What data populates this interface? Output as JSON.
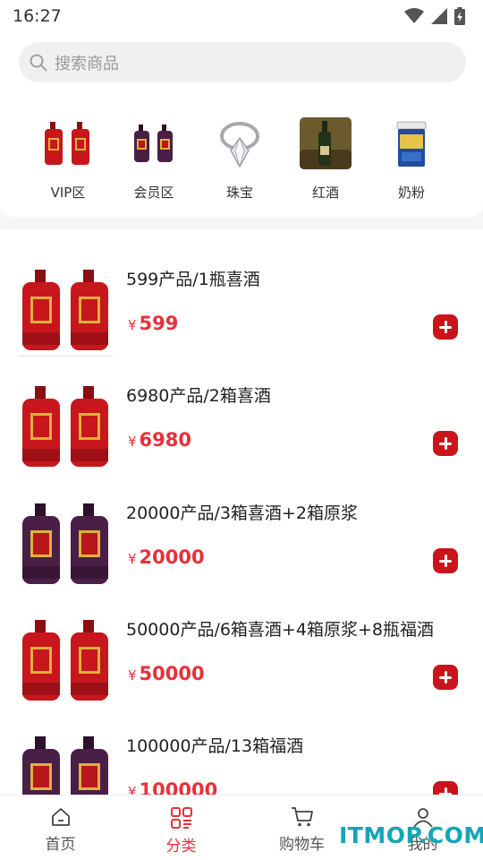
{
  "status_bar": {
    "time": "16:27"
  },
  "search": {
    "placeholder": "搜索商品"
  },
  "categories": [
    {
      "label": "VIP区",
      "icon": "red-liquor-bottles"
    },
    {
      "label": "会员区",
      "icon": "purple-liquor-bottles"
    },
    {
      "label": "珠宝",
      "icon": "diamond-ring"
    },
    {
      "label": "红酒",
      "icon": "red-wine-bottle"
    },
    {
      "label": "奶粉",
      "icon": "milk-powder-can"
    }
  ],
  "products": [
    {
      "title": "599产品/1瓶喜酒",
      "currency": "¥",
      "price": "599",
      "bottle_color": "red"
    },
    {
      "title": "6980产品/2箱喜酒",
      "currency": "¥",
      "price": "6980",
      "bottle_color": "red"
    },
    {
      "title": "20000产品/3箱喜酒+2箱原浆",
      "currency": "¥",
      "price": "20000",
      "bottle_color": "purple"
    },
    {
      "title": "50000产品/6箱喜酒+4箱原浆+8瓶福酒",
      "currency": "¥",
      "price": "50000",
      "bottle_color": "red"
    },
    {
      "title": "100000产品/13箱福酒",
      "currency": "¥",
      "price": "100000",
      "bottle_color": "purple"
    }
  ],
  "tabbar": [
    {
      "label": "首页",
      "icon": "home-icon",
      "active": false
    },
    {
      "label": "分类",
      "icon": "category-icon",
      "active": true
    },
    {
      "label": "购物车",
      "icon": "cart-icon",
      "active": false
    },
    {
      "label": "我的",
      "icon": "user-icon",
      "active": false
    }
  ],
  "watermark": "ITMOP.COM",
  "colors": {
    "accent": "#e8303a",
    "add_button": "#c9141c",
    "bottle_red": "#c8161d",
    "bottle_purple": "#4a1f45",
    "label_gold": "#e0b040",
    "watermark": "#14a6b8"
  }
}
